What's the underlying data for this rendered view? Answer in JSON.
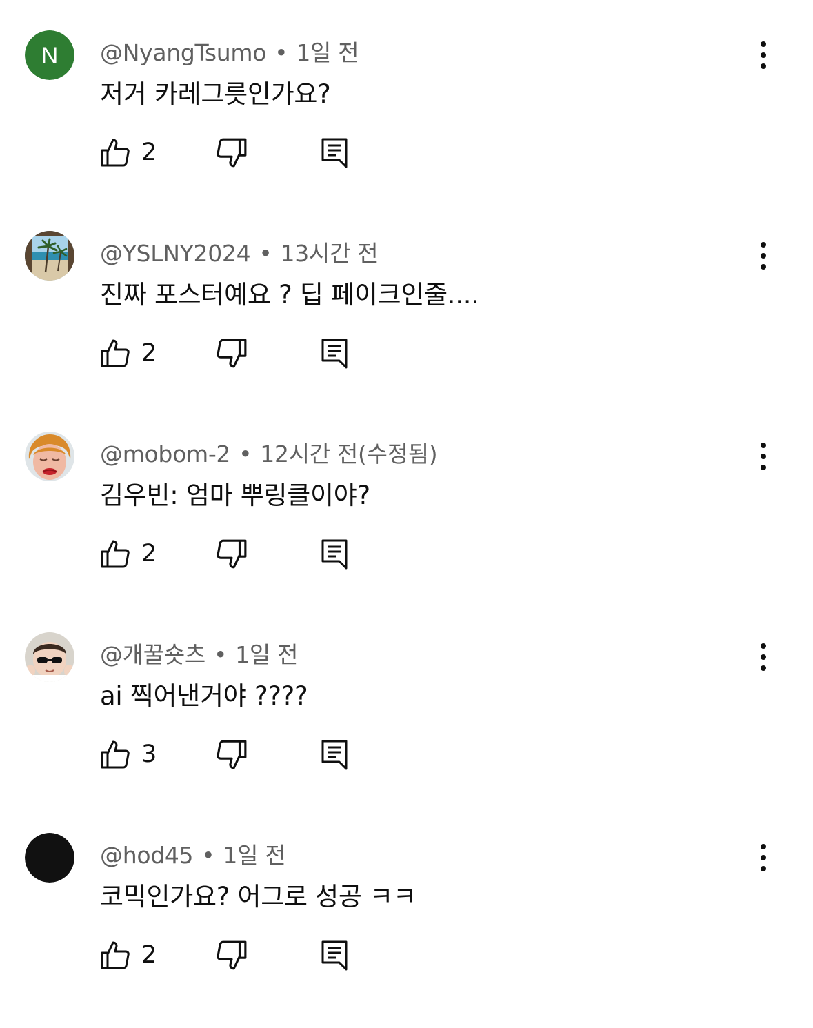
{
  "comments": [
    {
      "author": "@NyangTsumo",
      "time": "1일 전",
      "text": "저거 카레그릇인가요?",
      "likes": "2",
      "avatar": {
        "type": "initial",
        "letter": "N",
        "bg": "#2e7d32"
      }
    },
    {
      "author": "@YSLNY2024",
      "time": "13시간 전",
      "text": "진짜 포스터예요 ? 딥 페이크인줄....",
      "likes": "2",
      "avatar": {
        "type": "beach-photo"
      }
    },
    {
      "author": "@mobom-2",
      "time": "12시간 전(수정됨)",
      "text": "김우빈: 엄마 뿌링클이야?",
      "likes": "2",
      "avatar": {
        "type": "face-illustration"
      }
    },
    {
      "author": "@개꿀숏츠",
      "time": "1일 전",
      "text": "ai 찍어낸거야 ????",
      "likes": "3",
      "avatar": {
        "type": "baby-sunglasses-photo"
      }
    },
    {
      "author": "@hod45",
      "time": "1일 전",
      "text": "코믹인가요? 어그로 성공 ㅋㅋ",
      "likes": "2",
      "avatar": {
        "type": "solid",
        "bg": "#111111"
      }
    }
  ],
  "separator": "•",
  "icons": {
    "like": "thumbs-up-icon",
    "dislike": "thumbs-down-icon",
    "reply": "reply-icon",
    "more": "more-vertical-icon"
  },
  "colors": {
    "meta": "#606060",
    "text": "#0f0f0f",
    "background": "#ffffff"
  }
}
